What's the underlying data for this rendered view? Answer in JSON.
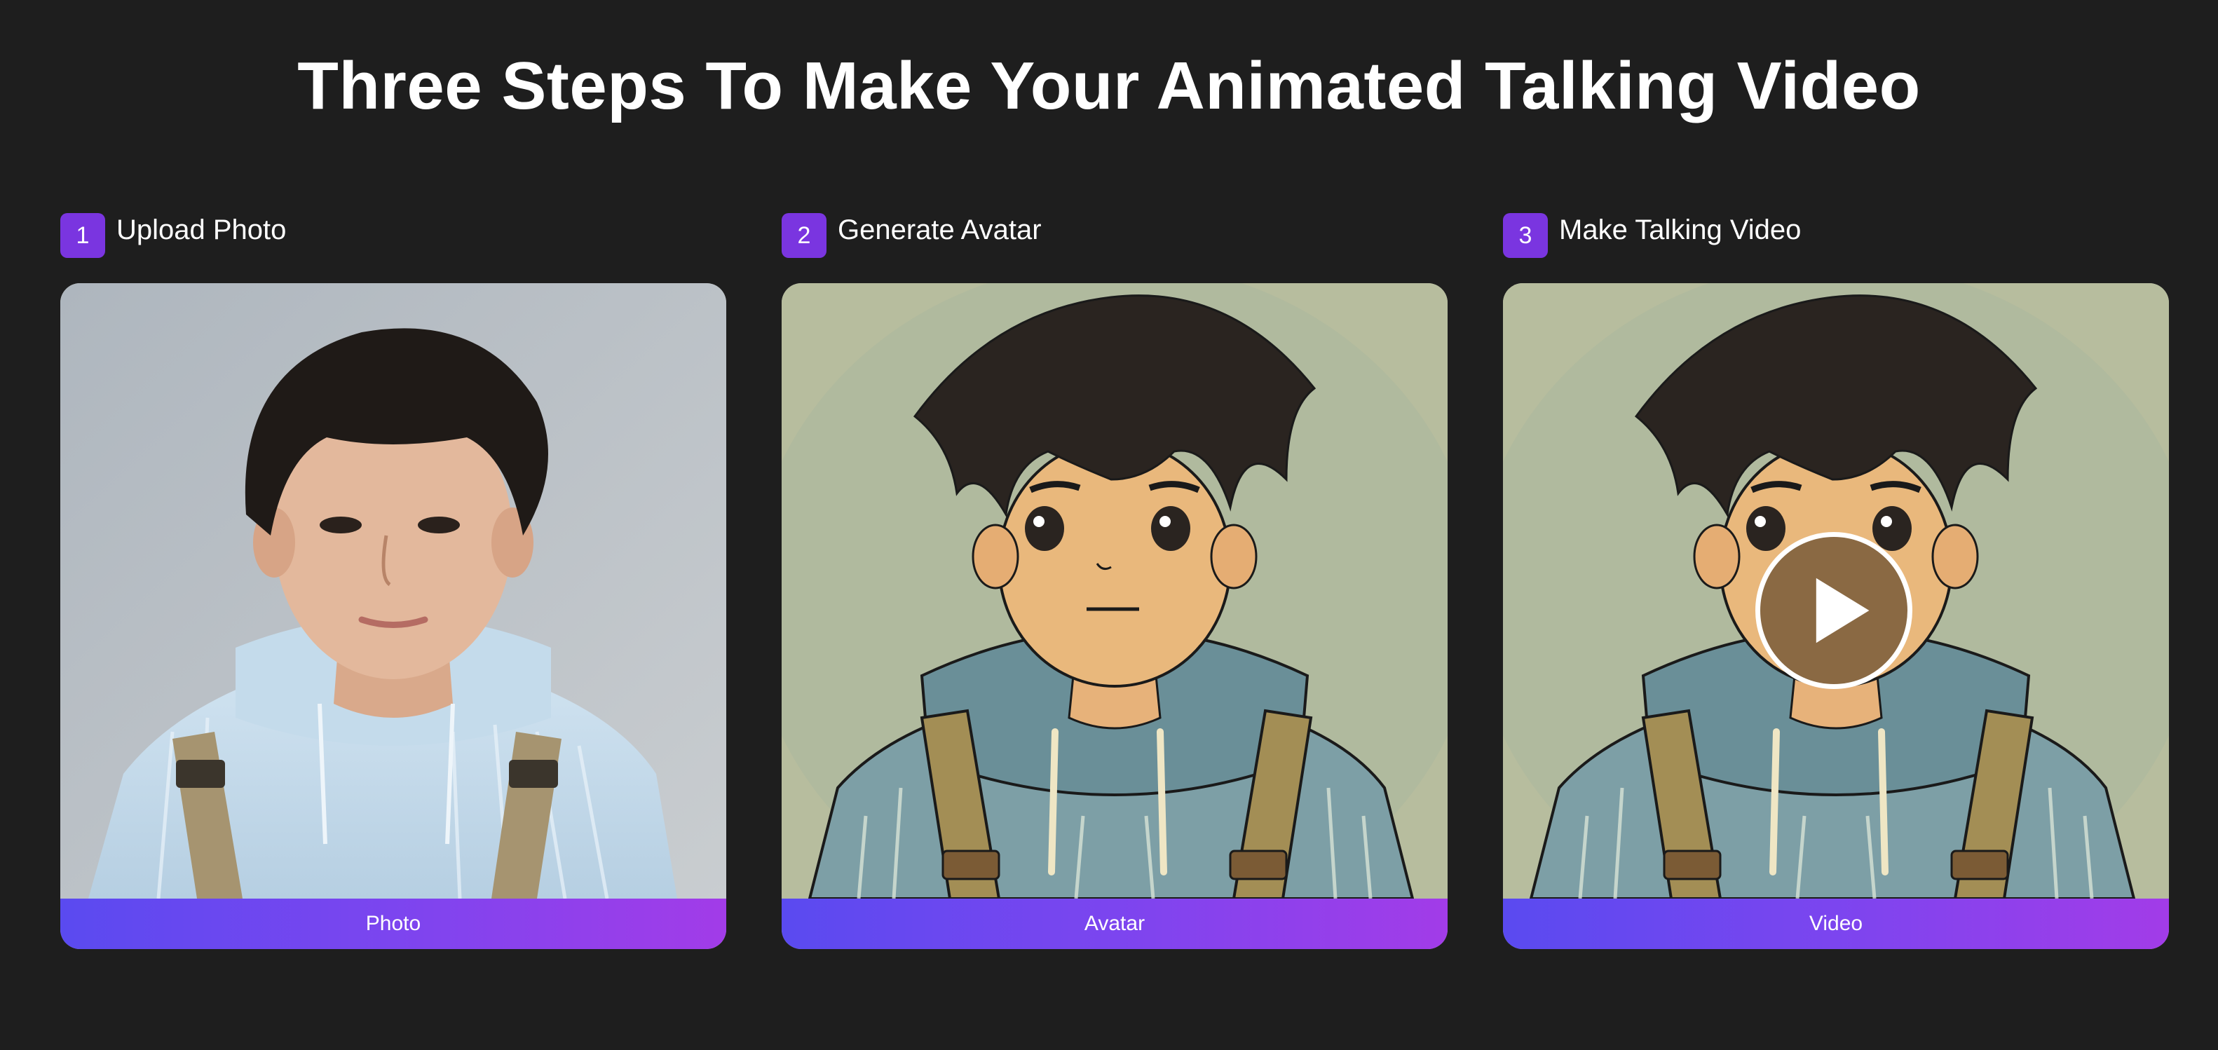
{
  "page": {
    "title": "Three Steps To Make Your Animated Talking Video"
  },
  "steps": [
    {
      "number": "1",
      "title": "Upload Photo",
      "caption": "Photo"
    },
    {
      "number": "2",
      "title": "Generate Avatar",
      "caption": "Avatar"
    },
    {
      "number": "3",
      "title": "Make Talking Video",
      "caption": "Video"
    }
  ],
  "icons": {
    "play": "play-icon"
  },
  "colors": {
    "background": "#1e1e1e",
    "badge": "#7a35e0",
    "caption_gradient_start": "#5a4af0",
    "caption_gradient_end": "#a23ce8"
  }
}
